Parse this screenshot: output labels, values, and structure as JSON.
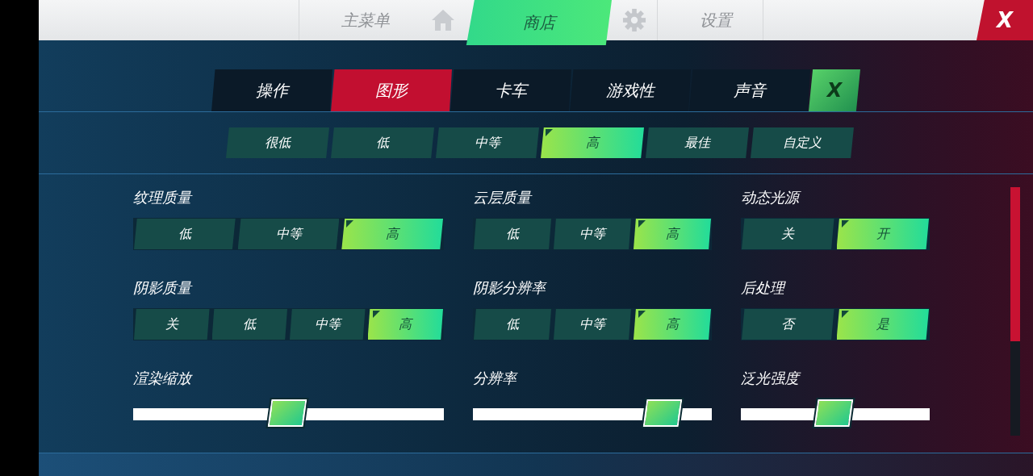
{
  "top_nav": {
    "items": [
      {
        "kind": "text",
        "label": "主菜单",
        "selected": false
      },
      {
        "kind": "home"
      },
      {
        "kind": "text",
        "label": "商店",
        "selected": true
      },
      {
        "kind": "gear"
      },
      {
        "kind": "text",
        "label": "设置",
        "selected": false
      }
    ],
    "close": "X"
  },
  "tabs": [
    {
      "label": "操作",
      "selected": false
    },
    {
      "label": "图形",
      "selected": true
    },
    {
      "label": "卡车",
      "selected": false
    },
    {
      "label": "游戏性",
      "selected": false
    },
    {
      "label": "声音",
      "selected": false
    }
  ],
  "tabs_close": "X",
  "presets": [
    {
      "label": "很低",
      "selected": false
    },
    {
      "label": "低",
      "selected": false
    },
    {
      "label": "中等",
      "selected": false
    },
    {
      "label": "高",
      "selected": true
    },
    {
      "label": "最佳",
      "selected": false
    },
    {
      "label": "自定义",
      "selected": false
    }
  ],
  "settings": [
    {
      "kind": "segmented",
      "label": "纹理质量",
      "options": [
        {
          "label": "低",
          "selected": false
        },
        {
          "label": "中等",
          "selected": false
        },
        {
          "label": "高",
          "selected": true
        }
      ]
    },
    {
      "kind": "segmented",
      "label": "云层质量",
      "options": [
        {
          "label": "低",
          "selected": false
        },
        {
          "label": "中等",
          "selected": false
        },
        {
          "label": "高",
          "selected": true
        }
      ]
    },
    {
      "kind": "segmented",
      "label": "动态光源",
      "options": [
        {
          "label": "关",
          "selected": false
        },
        {
          "label": "开",
          "selected": true
        }
      ]
    },
    {
      "kind": "segmented",
      "label": "阴影质量",
      "options": [
        {
          "label": "关",
          "selected": false
        },
        {
          "label": "低",
          "selected": false
        },
        {
          "label": "中等",
          "selected": false
        },
        {
          "label": "高",
          "selected": true
        }
      ]
    },
    {
      "kind": "segmented",
      "label": "阴影分辨率",
      "options": [
        {
          "label": "低",
          "selected": false
        },
        {
          "label": "中等",
          "selected": false
        },
        {
          "label": "高",
          "selected": true
        }
      ]
    },
    {
      "kind": "segmented",
      "label": "后处理",
      "options": [
        {
          "label": "否",
          "selected": false
        },
        {
          "label": "是",
          "selected": true
        }
      ]
    },
    {
      "kind": "slider",
      "label": "渲染缩放",
      "level": 0.5
    },
    {
      "kind": "slider",
      "label": "分辨率",
      "level": 0.8
    },
    {
      "kind": "slider",
      "label": "泛光强度",
      "level": 0.5
    }
  ]
}
